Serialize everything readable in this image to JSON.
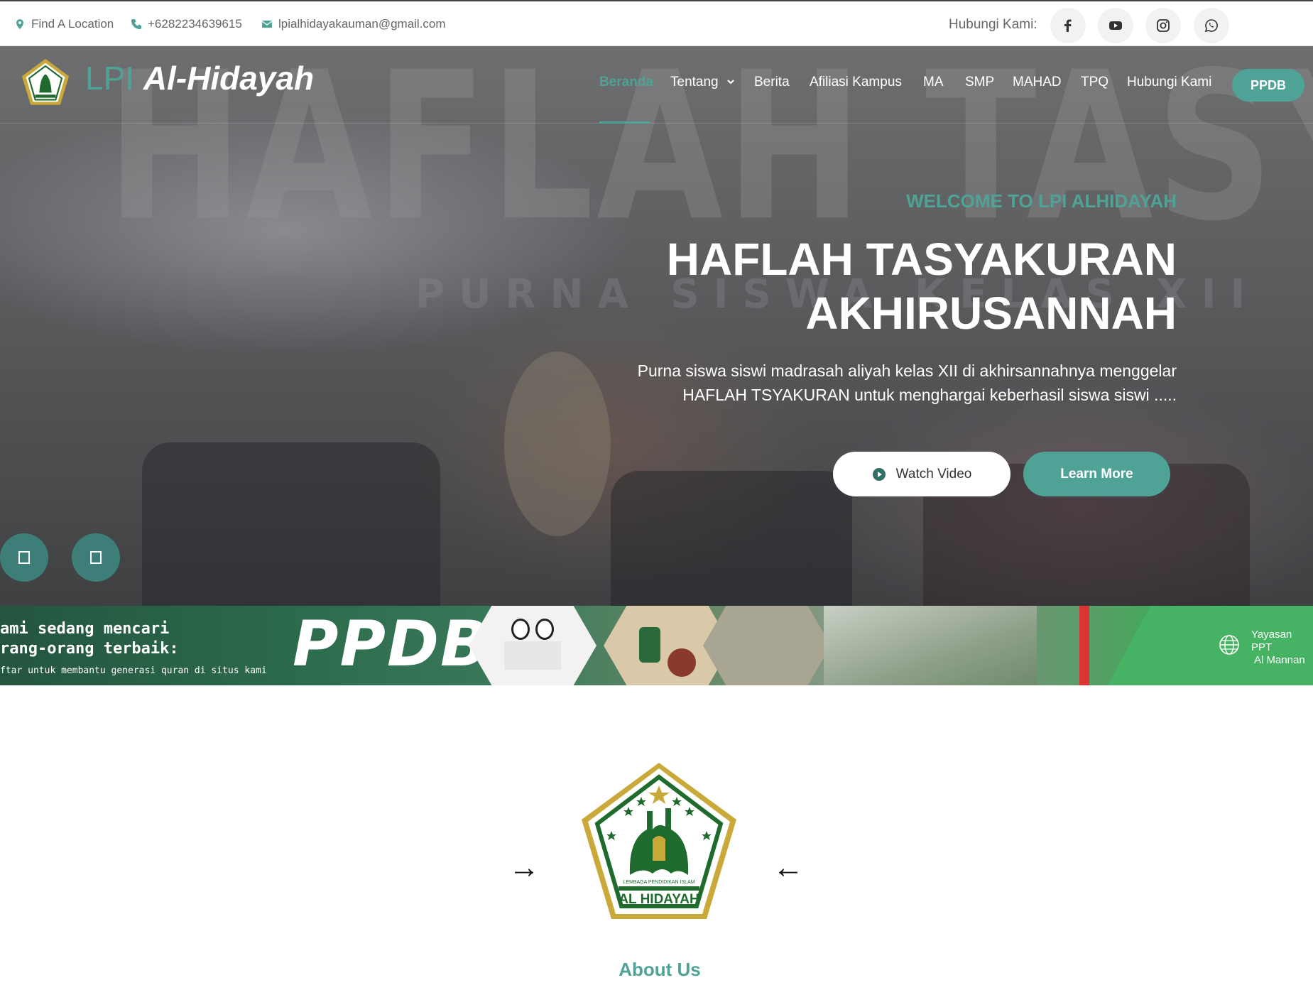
{
  "topbar": {
    "location": "Find A Location",
    "phone": "+6282234639615",
    "email": "lpialhidayakauman@gmail.com",
    "contact_label": "Hubungi Kami:",
    "socials": [
      "facebook-icon",
      "youtube-icon",
      "instagram-icon",
      "whatsapp-icon"
    ]
  },
  "nav": {
    "brand_prefix": "LPI",
    "brand_name": "Al-Hidayah",
    "items": [
      "Beranda",
      "Tentang",
      "Berita",
      "Afiliasi Kampus",
      "MA",
      "SMP",
      "MAHAD",
      "TPQ",
      "Hubungi Kami"
    ],
    "active_item": "Beranda",
    "cta": "PPDB"
  },
  "hero": {
    "background_text": "HAFLAH TASYAKKUR",
    "background_subtext": "PURNA SISWA KELAS XII",
    "kicker": "WELCOME TO LPI ALHIDAYAH",
    "title_line1": "HAFLAH TASYAKURAN",
    "title_line2": "AKHIRUSANNAH",
    "description_line1": "Purna siswa siswi madrasah aliyah kelas XII di akhirsannahnya menggelar",
    "description_line2": "HAFLAH TSYAKURAN untuk menghargai keberhasil siswa siswi .....",
    "watch_video": "Watch Video",
    "learn_more": "Learn More"
  },
  "banner": {
    "line1": "ami sedang mencari",
    "line2": "rang-orang terbaik:",
    "line3": "ftar untuk membantu generasi quran di situs kami",
    "ppdb": "PPDB",
    "yayasan_line1": "Yayasan PPT",
    "yayasan_line2": "Al Mannan"
  },
  "about": {
    "logo_text": "AL HIDAYAH",
    "logo_subtext": "LEMBAGA PENDIDIKAN ISLAM",
    "arrow_left": "→",
    "arrow_right": "←",
    "title": "About Us"
  },
  "colors": {
    "accent": "#4fa396",
    "logo_green": "#1f6b2e",
    "logo_gold": "#c9a93a"
  }
}
